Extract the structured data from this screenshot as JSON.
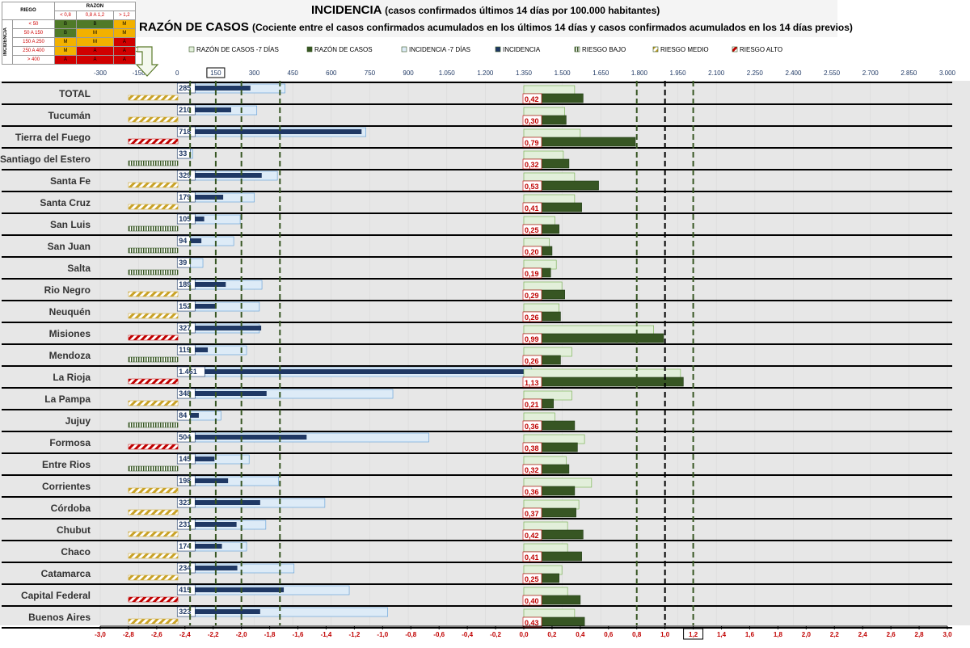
{
  "header": {
    "title_main": "INCIDENCIA",
    "title_main_note": "(casos confirmados últimos 14 días por 100.000 habitantes)",
    "title_second": "RAZÓN DE CASOS",
    "title_second_note": "(Cociente entre el casos confirmados acumulados en los últimos 14 días y casos confirmados acumulados en los 14 días previos)"
  },
  "risk_table": {
    "col_title": "RIEGO",
    "razon_title": "RAZON",
    "razon_cols": [
      "< 0,8",
      "0,8 A 1,2",
      "> 1,2"
    ],
    "row_title": "INCIDENCIA",
    "rows": [
      {
        "label": "< 50",
        "cells": [
          "B",
          "B",
          "M"
        ]
      },
      {
        "label": "50 A 150",
        "cells": [
          "B",
          "M",
          "M"
        ]
      },
      {
        "label": "150 A 250",
        "cells": [
          "M",
          "M",
          "A"
        ]
      },
      {
        "label": "250 A 400",
        "cells": [
          "M",
          "A",
          "A"
        ]
      },
      {
        "label": "> 400",
        "cells": [
          "A",
          "A",
          "A"
        ]
      }
    ]
  },
  "chart_data": {
    "type": "bar",
    "orientation": "horizontal",
    "legend_position": "top",
    "legend": [
      {
        "key": "razon7",
        "label": "RAZÓN DE CASOS -7 DÍAS",
        "color": "#e2efda"
      },
      {
        "key": "razon",
        "label": "RAZÓN DE CASOS",
        "color": "#375623"
      },
      {
        "key": "inc7",
        "label": "INCIDENCIA -7 DÍAS",
        "color": "#ddebf7"
      },
      {
        "key": "inc",
        "label": "INCIDENCIA",
        "color": "#1f3864"
      },
      {
        "key": "bajo",
        "label": "RIESGO BAJO",
        "color": "#375623"
      },
      {
        "key": "medio",
        "label": "RIESGO MEDIO",
        "color": "#c9a227"
      },
      {
        "key": "alto",
        "label": "RIESGO ALTO",
        "color": "#c00000"
      }
    ],
    "top_axis": {
      "min": -300,
      "max": 3000,
      "ticks": [
        "-300",
        "-150",
        "0",
        "150",
        "300",
        "450",
        "600",
        "750",
        "900",
        "1.050",
        "1.200",
        "1.350",
        "1.500",
        "1.650",
        "1.800",
        "1.950",
        "2.100",
        "2.250",
        "2.400",
        "2.550",
        "2.700",
        "2.850",
        "3.000"
      ],
      "boxed_tick": "150"
    },
    "bottom_axis": {
      "min": -3.0,
      "max": 3.0,
      "ticks": [
        "-3,0",
        "-2,8",
        "-2,6",
        "-2,4",
        "-2,2",
        "-2,0",
        "-1,8",
        "-1,6",
        "-1,4",
        "-1,2",
        "-1,0",
        "-0,8",
        "-0,6",
        "-0,4",
        "-0,2",
        "0,0",
        "0,2",
        "0,4",
        "0,6",
        "0,8",
        "1,0",
        "1,2",
        "1,4",
        "1,6",
        "1,8",
        "2,0",
        "2,2",
        "2,4",
        "2,6",
        "2,8",
        "3,0"
      ],
      "boxed_tick": "1,2"
    },
    "reference_lines_incidencia": [
      50,
      150,
      250,
      400
    ],
    "reference_lines_razon": [
      0.8,
      1.0,
      1.2
    ],
    "categories": [
      "TOTAL",
      "Tucumán",
      "Tierra del Fuego",
      "Santiago del Estero",
      "Santa Fe",
      "Santa Cruz",
      "San Luis",
      "San Juan",
      "Salta",
      "Rio Negro",
      "Neuquén",
      "Misiones",
      "Mendoza",
      "La Rioja",
      "La Pampa",
      "Jujuy",
      "Formosa",
      "Entre Rios",
      "Corrientes",
      "Córdoba",
      "Chubut",
      "Chaco",
      "Catamarca",
      "Capital Federal",
      "Buenos Aires"
    ],
    "incidencia_labels": [
      "285",
      "210",
      "718",
      "33",
      "329",
      "179",
      "105",
      "94",
      "39",
      "189",
      "152",
      "327",
      "119",
      "1.461",
      "348",
      "84",
      "504",
      "145",
      "198",
      "323",
      "231",
      "174",
      "234",
      "415",
      "323"
    ],
    "series": [
      {
        "key": "inc",
        "name": "INCIDENCIA",
        "values": [
          285,
          210,
          718,
          33,
          329,
          179,
          105,
          94,
          39,
          189,
          152,
          327,
          119,
          1461,
          348,
          84,
          504,
          145,
          198,
          323,
          231,
          174,
          234,
          415,
          323
        ]
      },
      {
        "key": "inc7",
        "name": "INCIDENCIA -7 DÍAS",
        "values": [
          420,
          310,
          735,
          60,
          390,
          300,
          245,
          220,
          100,
          330,
          320,
          320,
          270,
          1380,
          840,
          170,
          980,
          280,
          395,
          575,
          345,
          270,
          455,
          670,
          820
        ]
      },
      {
        "key": "razon",
        "name": "RAZÓN DE CASOS",
        "values": [
          0.42,
          0.3,
          0.79,
          0.32,
          0.53,
          0.41,
          0.25,
          0.2,
          0.19,
          0.29,
          0.26,
          0.99,
          0.26,
          1.13,
          0.21,
          0.36,
          0.38,
          0.32,
          0.36,
          0.37,
          0.42,
          0.41,
          0.25,
          0.4,
          0.43
        ]
      },
      {
        "key": "razon7",
        "name": "RAZÓN DE CASOS -7 DÍAS",
        "values": [
          0.36,
          0.29,
          0.4,
          0.28,
          0.36,
          0.36,
          0.22,
          0.18,
          0.23,
          0.27,
          0.25,
          0.92,
          0.34,
          1.11,
          0.34,
          0.22,
          0.43,
          0.3,
          0.48,
          0.39,
          0.31,
          0.31,
          0.27,
          0.31,
          0.36
        ]
      },
      {
        "key": "razon_labels",
        "name": "RAZÓN DE CASOS",
        "labels": [
          "0,42",
          "0,30",
          "0,79",
          "0,32",
          "0,53",
          "0,41",
          "0,25",
          "0,20",
          "0,19",
          "0,29",
          "0,26",
          "0,99",
          "0,26",
          "1,13",
          "0,21",
          "0,36",
          "0,38",
          "0,32",
          "0,36",
          "0,37",
          "0,42",
          "0,41",
          "0,25",
          "0,40",
          "0,43"
        ]
      }
    ],
    "risk": [
      "medio",
      "medio",
      "alto",
      "bajo",
      "medio",
      "medio",
      "bajo",
      "bajo",
      "bajo",
      "medio",
      "medio",
      "alto",
      "bajo",
      "alto",
      "medio",
      "bajo",
      "alto",
      "bajo",
      "medio",
      "medio",
      "medio",
      "medio",
      "medio",
      "alto",
      "medio"
    ]
  }
}
